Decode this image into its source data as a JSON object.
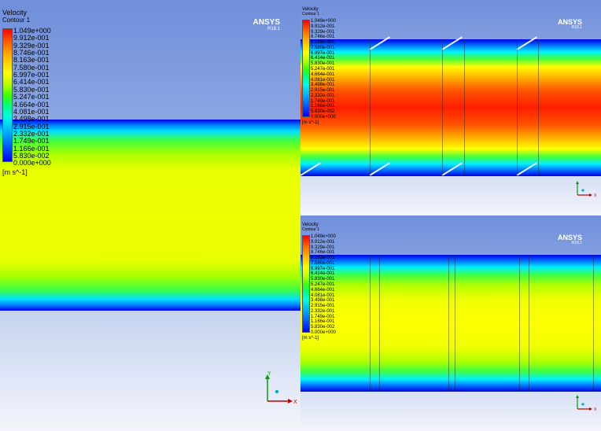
{
  "views": [
    {
      "title": "Velocity",
      "subtitle": "Contour 1",
      "legend_values": [
        "1.049e+000",
        "9.912e-001",
        "9.329e-001",
        "8.746e-001",
        "8.163e-001",
        "7.580e-001",
        "6.997e-001",
        "6.414e-001",
        "5.830e-001",
        "5.247e-001",
        "4.664e-001",
        "4.081e-001",
        "3.498e-001",
        "2.915e-001",
        "2.332e-001",
        "1.749e-001",
        "1.166e-001",
        "5.830e-002",
        "0.000e+000"
      ],
      "unit": "[m s^-1]",
      "logo": "ANSYS",
      "version": "R18.1",
      "axis_x": "X",
      "axis_y": "Y"
    },
    {
      "title": "Velocity",
      "subtitle": "Contour 1",
      "legend_values": [
        "1.049e+000",
        "9.912e-001",
        "9.329e-001",
        "8.746e-001",
        "8.163e-001",
        "7.580e-001",
        "6.997e-001",
        "6.414e-001",
        "5.830e-001",
        "5.247e-001",
        "4.664e-001",
        "4.081e-001",
        "3.498e-001",
        "2.915e-001",
        "2.332e-001",
        "1.749e-001",
        "1.166e-001",
        "5.830e-002",
        "0.000e+000"
      ],
      "unit": "[m s^-1]",
      "logo": "ANSYS",
      "version": "R18.1",
      "axis_x": "X",
      "axis_y": "Y"
    },
    {
      "title": "Velocity",
      "subtitle": "Contour 1",
      "legend_values": [
        "1.049e+000",
        "9.912e-001",
        "9.329e-001",
        "8.746e-001",
        "8.163e-001",
        "7.580e-001",
        "6.997e-001",
        "6.414e-001",
        "5.830e-001",
        "5.247e-001",
        "4.664e-001",
        "4.081e-001",
        "3.498e-001",
        "2.915e-001",
        "2.332e-001",
        "1.749e-001",
        "1.166e-001",
        "5.830e-002",
        "0.000e+000"
      ],
      "unit": "[m s^-1]",
      "logo": "ANSYS",
      "version": "R18.1",
      "axis_x": "X",
      "axis_y": "Y"
    }
  ],
  "colors": {
    "background_top": "#6f8fdc",
    "background_bottom": "#f3f5fb",
    "max_velocity": "#ff0000",
    "min_velocity": "#0000ff"
  }
}
